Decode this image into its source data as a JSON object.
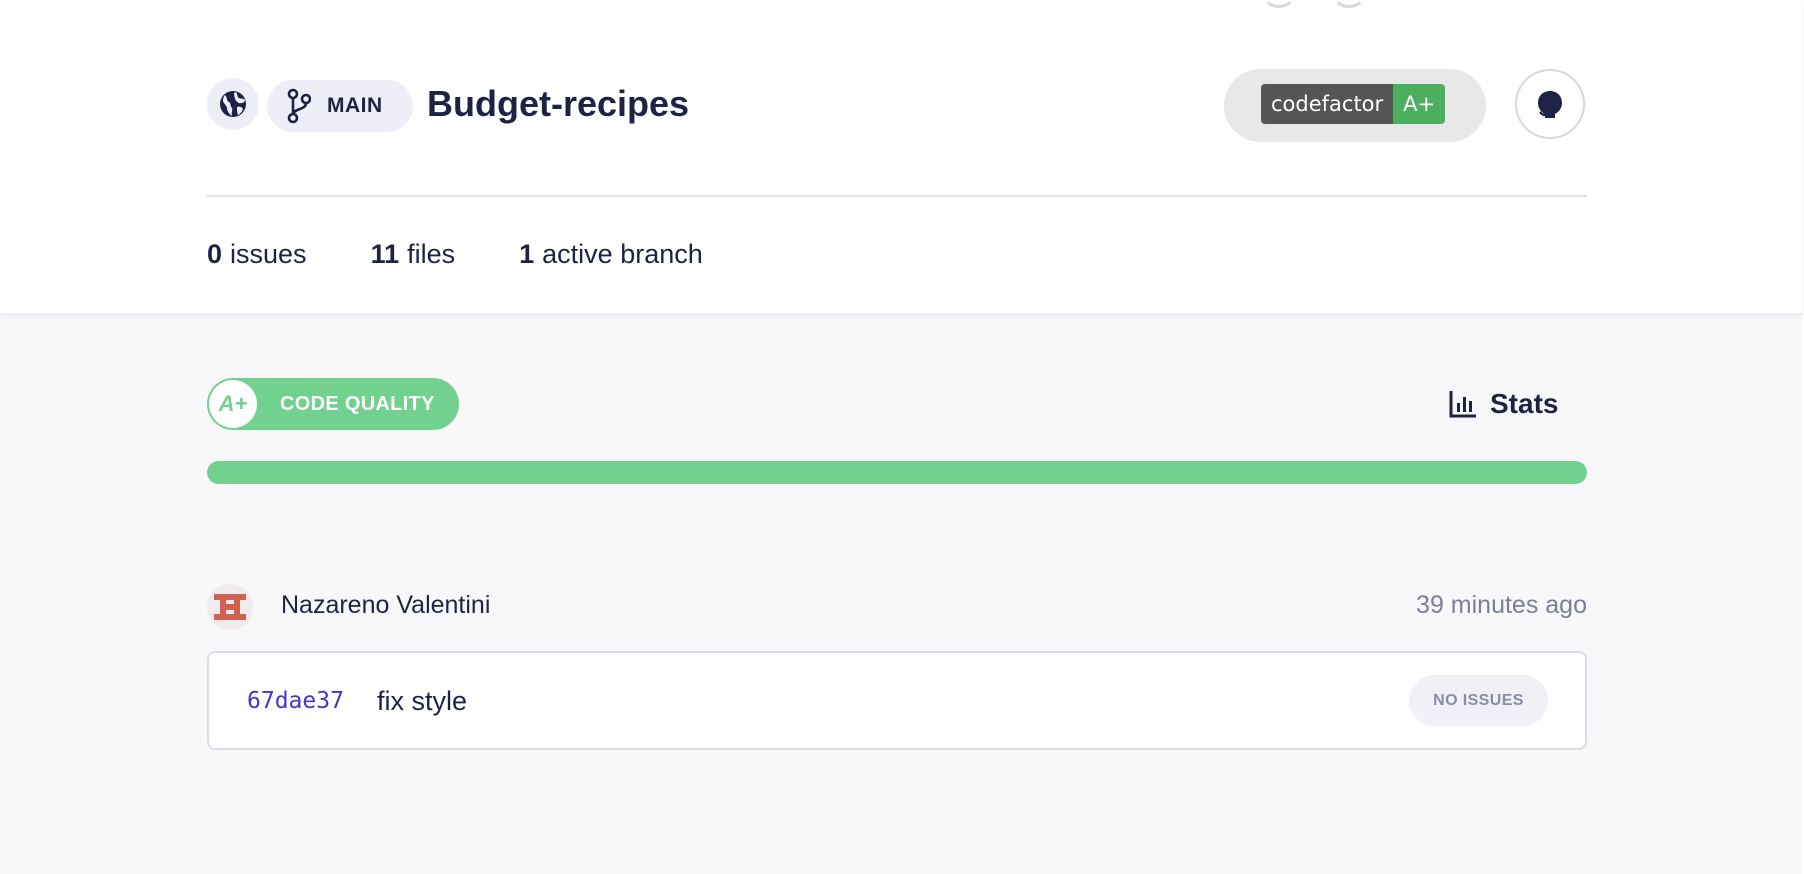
{
  "colors": {
    "text_primary": "#1f2245",
    "accent_green": "#72d18f",
    "sha_link": "#4636c8",
    "muted": "#7c7e95",
    "badge_dark": "#555555",
    "badge_green": "#4caf5f"
  },
  "header": {
    "visibility_icon": "globe-icon",
    "branch": {
      "icon": "git-branch-icon",
      "label": "MAIN"
    },
    "repo_name": "Budget-recipes",
    "grade_badge": {
      "left_text": "codefactor",
      "right_text": "A+"
    },
    "github_icon": "github-icon",
    "stats": [
      {
        "count": "0",
        "label": "issues"
      },
      {
        "count": "11",
        "label": "files"
      },
      {
        "count": "1",
        "label": "active branch"
      }
    ]
  },
  "quality": {
    "grade": "A+",
    "label": "CODE QUALITY",
    "progress_percent": 100
  },
  "stats_link": {
    "icon": "bar-chart-icon",
    "label": "Stats"
  },
  "commit": {
    "author": "Nazareno Valentini",
    "time_ago": "39 minutes ago",
    "sha": "67dae37",
    "message": "fix style",
    "issues_label": "NO ISSUES"
  }
}
